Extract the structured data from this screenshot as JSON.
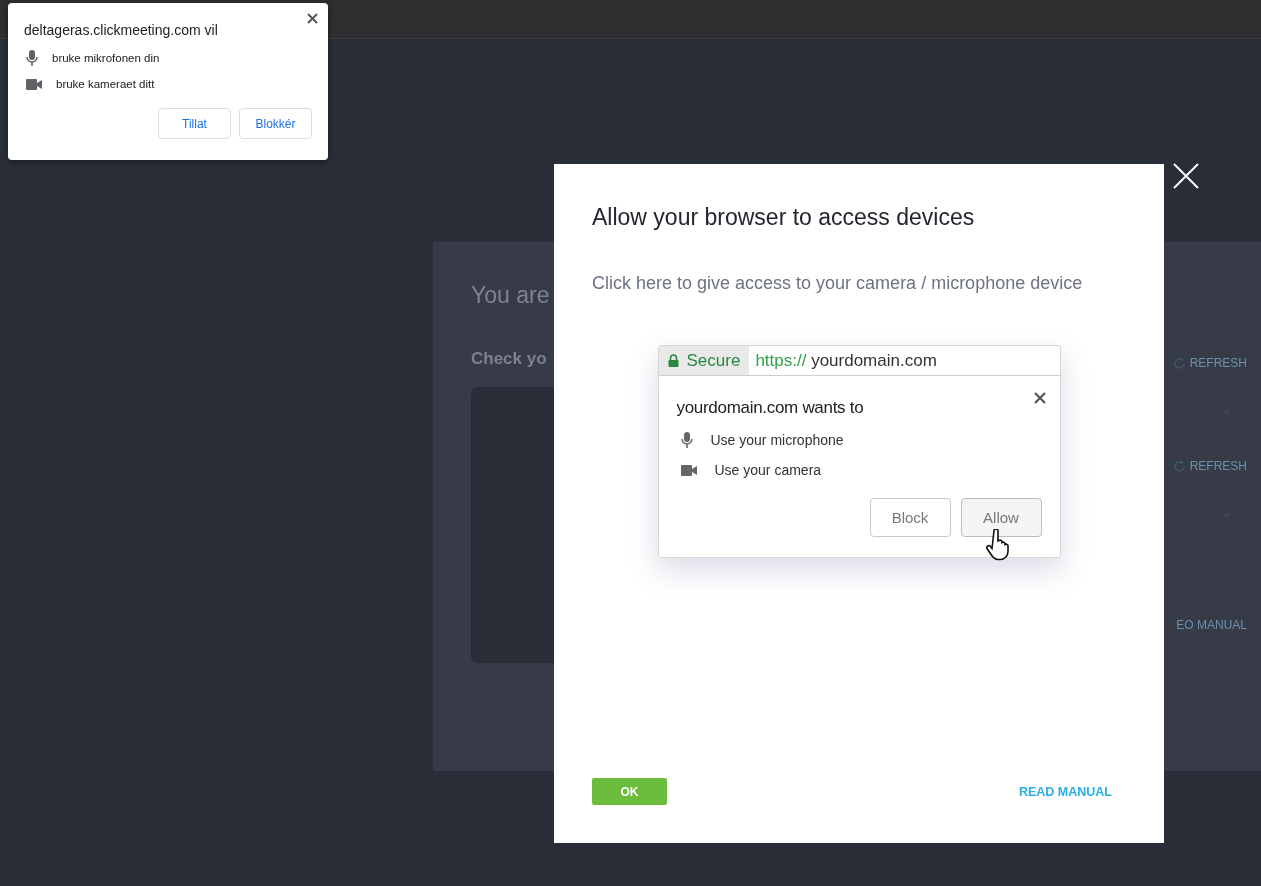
{
  "browser_prompt": {
    "title": "deltageras.clickmeeting.com vil",
    "permissions": [
      {
        "kind": "microphone",
        "label": "bruke mikrofonen din"
      },
      {
        "kind": "camera",
        "label": "bruke kameraet ditt"
      }
    ],
    "buttons": [
      "Tillat",
      "Blokkér"
    ]
  },
  "background": {
    "heading": "You are",
    "subheading": "Check yo",
    "refresh_links": [
      "REFRESH",
      "REFRESH"
    ],
    "manual_link": "EO MANUAL"
  },
  "modal": {
    "title": "Allow your browser to access devices",
    "instruction": "Click here to give access to your camera / microphone device",
    "illustration": {
      "secure_label": "Secure",
      "url_scheme": "https://",
      "url_host": "yourdomain.com",
      "prompt_title": "yourdomain.com wants to",
      "permissions": [
        {
          "kind": "microphone",
          "label": "Use your microphone"
        },
        {
          "kind": "camera",
          "label": "Use your camera"
        }
      ],
      "buttons": [
        {
          "label": "Block",
          "highlighted": false
        },
        {
          "label": "Allow",
          "highlighted": true
        }
      ]
    },
    "ok_button": "OK",
    "manual_link": "READ MANUAL"
  }
}
